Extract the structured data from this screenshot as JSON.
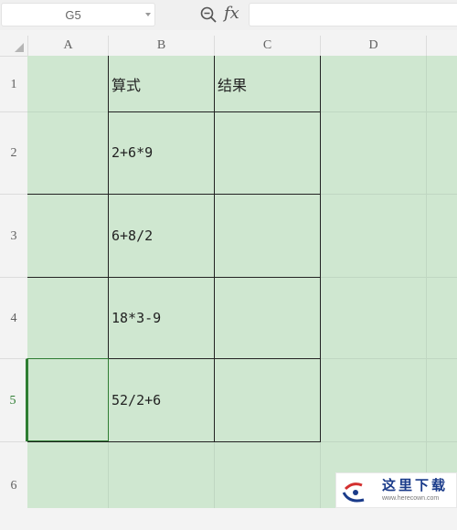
{
  "formula_bar": {
    "name_box_value": "G5",
    "fx_label": "fx",
    "formula_value": ""
  },
  "columns": [
    "A",
    "B",
    "C",
    "D"
  ],
  "rows": [
    "1",
    "2",
    "3",
    "4",
    "5",
    "6"
  ],
  "active_cell": "G5",
  "cells": {
    "B1": "算式",
    "C1": "结果",
    "B2": "2+6*9",
    "B3": "6+8/2",
    "B4": "18*3-9",
    "B5": "52/2+6"
  },
  "watermark": {
    "text_cn": "这里下载",
    "url": "www.herecown.com"
  },
  "colors": {
    "grid_bg": "#cfe7d0",
    "active_row": "#2e7d32"
  }
}
